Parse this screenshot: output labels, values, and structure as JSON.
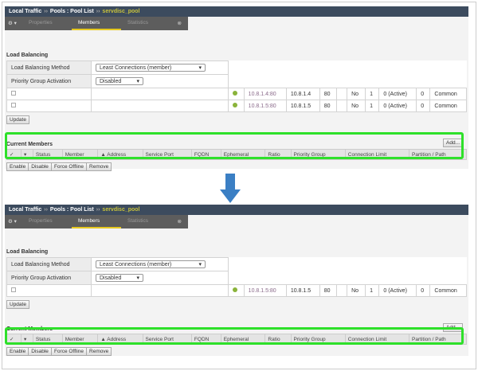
{
  "breadcrumb": {
    "a": "Local Traffic",
    "sep": "››",
    "b": "Pools : Pool List",
    "pool": "servdisc_pool"
  },
  "tabs": {
    "gear": "⚙ ▾",
    "properties": "Properties",
    "members": "Members",
    "statistics": "Statistics",
    "x": "⊗"
  },
  "load_balancing": {
    "title": "Load Balancing",
    "method_label": "Load Balancing Method",
    "method_value": "Least Connections (member)",
    "pga_label": "Priority Group Activation",
    "pga_value": "Disabled",
    "update": "Update"
  },
  "members": {
    "title": "Current Members",
    "add": "Add...",
    "columns": [
      "✓",
      "▾",
      "Status",
      "Member",
      "▲ Address",
      "Service Port",
      "FQDN",
      "Ephemeral",
      "Ratio",
      "Priority Group",
      "Connection Limit",
      "Partition / Path"
    ],
    "before": [
      {
        "member": "10.8.1.4:80",
        "address": "10.8.1.4",
        "port": "80",
        "fqdn": "",
        "ephemeral": "No",
        "ratio": "1",
        "priority": "0 (Active)",
        "limit": "0",
        "partition": "Common"
      },
      {
        "member": "10.8.1.5:80",
        "address": "10.8.1.5",
        "port": "80",
        "fqdn": "",
        "ephemeral": "No",
        "ratio": "1",
        "priority": "0 (Active)",
        "limit": "0",
        "partition": "Common"
      }
    ],
    "after": [
      {
        "member": "10.8.1.5:80",
        "address": "10.8.1.5",
        "port": "80",
        "fqdn": "",
        "ephemeral": "No",
        "ratio": "1",
        "priority": "0 (Active)",
        "limit": "0",
        "partition": "Common"
      }
    ],
    "actions": [
      "Enable",
      "Disable",
      "Force Offline",
      "Remove"
    ]
  },
  "colors": {
    "highlight": "#2ee02a",
    "arrow": "#3b7fc4",
    "header": "#3c4b5e"
  }
}
